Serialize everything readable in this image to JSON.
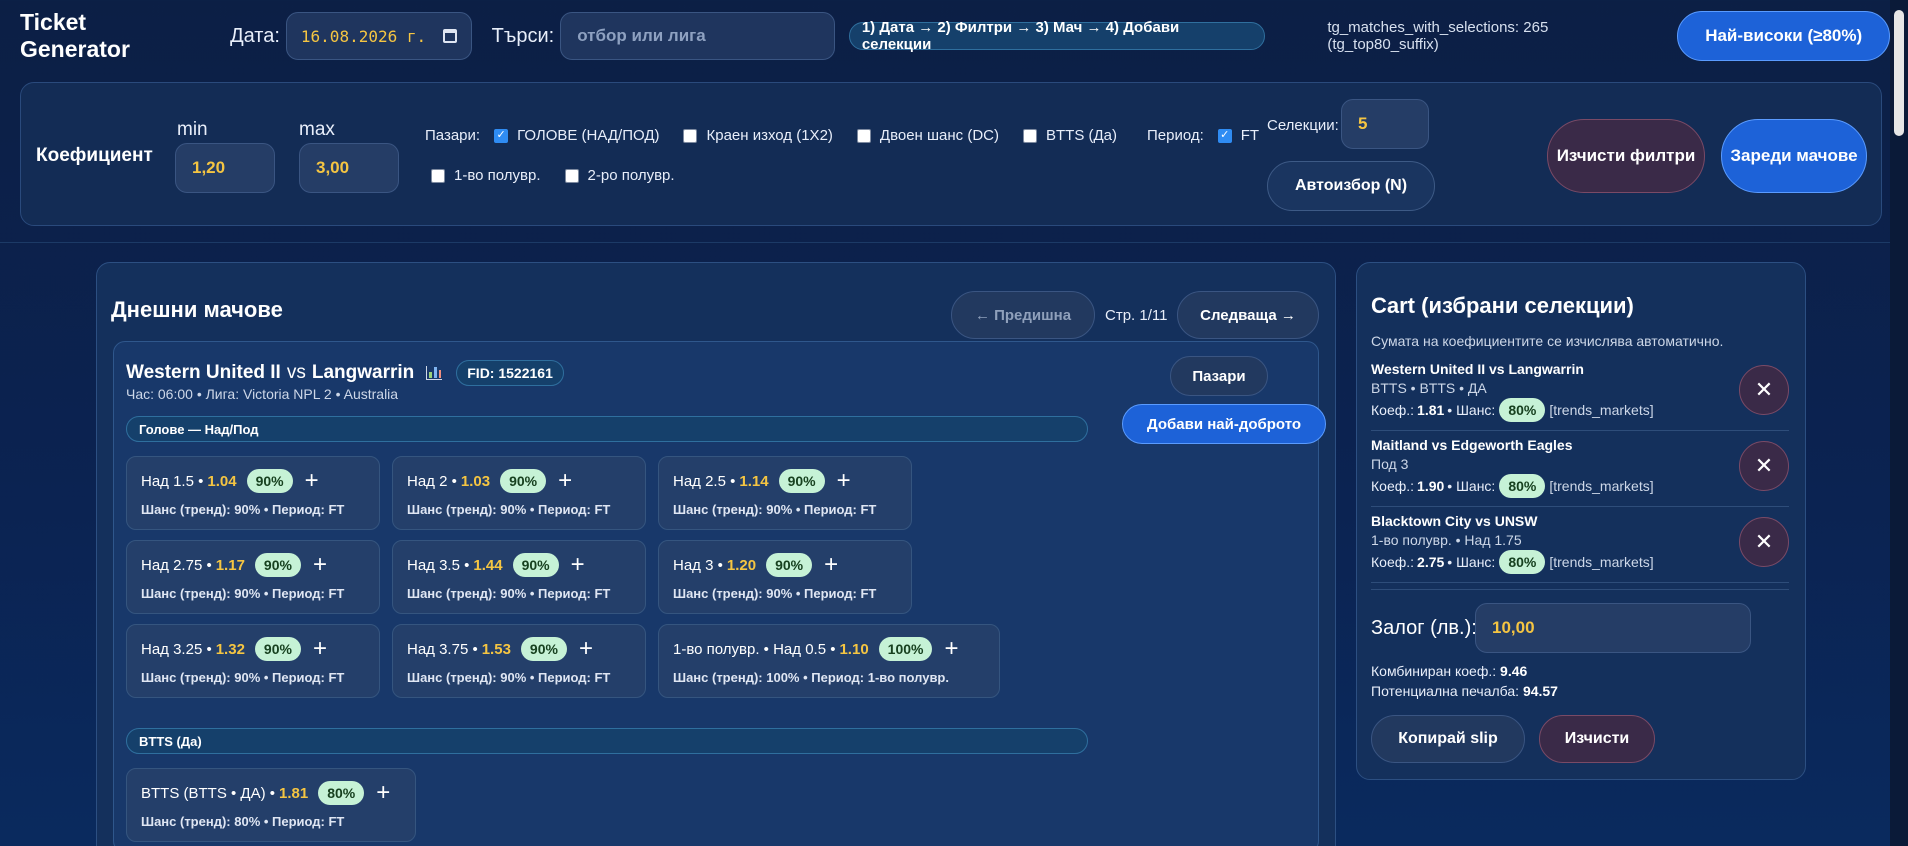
{
  "header": {
    "app_title": "Ticket Generator",
    "date_label": "Дата:",
    "date_value": "16.08.2026 г.",
    "search_label": "Търси:",
    "search_placeholder": "отбор или лига",
    "steps": "1) Дата → 2) Филтри → 3) Мач → 4) Добави селекции",
    "meta": "tg_matches_with_selections: 265 (tg_top80_suffix)",
    "top_button": "Най-високи (≥80%)"
  },
  "filters": {
    "title": "Коефициент",
    "min_label": "min",
    "min_value": "1,20",
    "max_label": "max",
    "max_value": "3,00",
    "markets_label": "Пазари:",
    "markets": [
      {
        "label": "ГОЛОВЕ (НАД/ПОД)",
        "checked": true
      },
      {
        "label": "Краен изход (1X2)",
        "checked": false
      },
      {
        "label": "Двоен шанс (DC)",
        "checked": false
      },
      {
        "label": "BTTS (Да)",
        "checked": false
      }
    ],
    "period_label": "Период:",
    "periods": [
      {
        "label": "FT",
        "checked": true
      },
      {
        "label": "1-во полувр.",
        "checked": false
      },
      {
        "label": "2-ро полувр.",
        "checked": false
      }
    ],
    "selections_label": "Селекции:",
    "selections_value": "5",
    "auto_button": "Автоизбор (N)",
    "clear_button": "Изчисти филтри",
    "load_button": "Зареди мачове"
  },
  "matches": {
    "title": "Днешни мачове",
    "prev_button": "← Предишна",
    "page_info": "Стр. 1/11",
    "next_button": "Следваща →",
    "match": {
      "home": "Western United II",
      "vs": "vs",
      "away": "Langwarrin",
      "fid": "FID: 1522161",
      "subtitle": "Час: 06:00 • Лига: Victoria NPL 2 • Australia",
      "markets_button": "Пазари",
      "best_button": "Добави най-доброто",
      "goals_section": "Голове — Над/Под",
      "goals": [
        {
          "label": "Над 1.5 •",
          "odds": "1.04",
          "chance": "90%",
          "info": "Шанс (тренд): 90% • Период: FT"
        },
        {
          "label": "Над 2 •",
          "odds": "1.03",
          "chance": "90%",
          "info": "Шанс (тренд): 90% • Период: FT"
        },
        {
          "label": "Над 2.5 •",
          "odds": "1.14",
          "chance": "90%",
          "info": "Шанс (тренд): 90% • Период: FT"
        },
        {
          "label": "Над 2.75 •",
          "odds": "1.17",
          "chance": "90%",
          "info": "Шанс (тренд): 90% • Период: FT"
        },
        {
          "label": "Над 3.5 •",
          "odds": "1.44",
          "chance": "90%",
          "info": "Шанс (тренд): 90% • Период: FT"
        },
        {
          "label": "Над 3 •",
          "odds": "1.20",
          "chance": "90%",
          "info": "Шанс (тренд): 90% • Период: FT"
        },
        {
          "label": "Над 3.25 •",
          "odds": "1.32",
          "chance": "90%",
          "info": "Шанс (тренд): 90% • Период: FT"
        },
        {
          "label": "Над 3.75 •",
          "odds": "1.53",
          "chance": "90%",
          "info": "Шанс (тренд): 90% • Период: FT"
        },
        {
          "label": "1-во полувр. • Над 0.5 •",
          "odds": "1.10",
          "chance": "100%",
          "info": "Шанс (тренд): 100% • Период: 1-во полувр."
        }
      ],
      "btts_section": "BTTS (Да)",
      "btts": [
        {
          "label": "BTTS (BTTS • ДА) •",
          "odds": "1.81",
          "chance": "80%",
          "info": "Шанс (тренд): 80% • Период: FT"
        }
      ]
    }
  },
  "cart": {
    "title": "Cart (избрани селекции)",
    "note": "Сумата на коефициентите се изчислява автоматично.",
    "items": [
      {
        "title": "Western United II vs Langwarrin",
        "sub": "BTTS • BTTS • ДА",
        "odds": "1.81",
        "chance": "80%",
        "tag": "[trends_markets]"
      },
      {
        "title": "Maitland vs Edgeworth Eagles",
        "sub": "Под 3",
        "odds": "1.90",
        "chance": "80%",
        "tag": "[trends_markets]"
      },
      {
        "title": "Blacktown City vs UNSW",
        "sub": "1-во полувр. • Над 1.75",
        "odds": "2.75",
        "chance": "80%",
        "tag": "[trends_markets]"
      }
    ],
    "odds_label": "Коеф.:",
    "chance_label": "• Шанс:",
    "stake_label": "Залог (лв.):",
    "stake_value": "10,00",
    "combined_label": "Комбиниран коеф.:",
    "combined_value": "9.46",
    "payout_label": "Потенциална печалба:",
    "payout_value": "94.57",
    "copy_button": "Копирай slip",
    "clear_button": "Изчисти"
  }
}
